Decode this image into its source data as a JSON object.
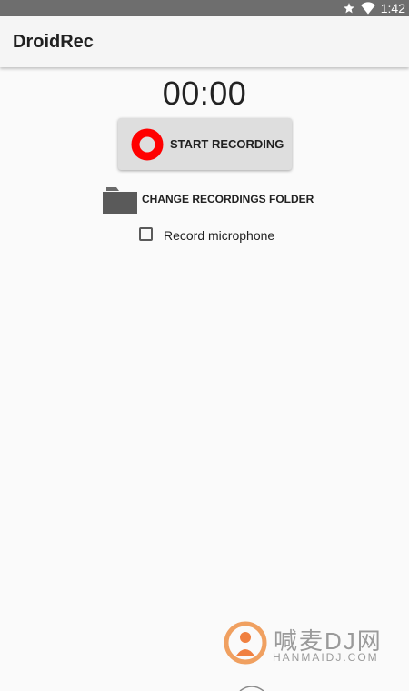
{
  "status_bar": {
    "time": "1:42",
    "icons": [
      "star-icon",
      "wifi-icon"
    ]
  },
  "app_bar": {
    "title": "DroidRec"
  },
  "timer": {
    "value": "00:00"
  },
  "record_button": {
    "label": "START RECORDING",
    "icon": "record-icon",
    "icon_color": "#ff0000"
  },
  "folder": {
    "label": "CHANGE RECORDINGS FOLDER",
    "icon": "folder-icon"
  },
  "microphone": {
    "label": "Record microphone",
    "checked": false
  },
  "watermark": {
    "text_cn": "喊麦DJ网",
    "url": "HANMAIDJ.COM"
  }
}
